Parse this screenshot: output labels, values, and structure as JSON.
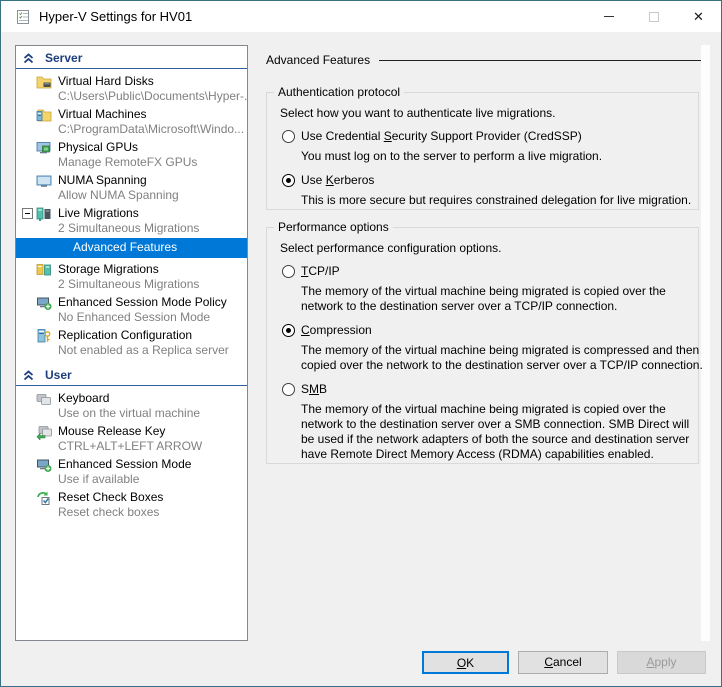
{
  "window": {
    "title": "Hyper-V Settings for HV01",
    "close_glyph": "✕"
  },
  "sidebar": {
    "sections": [
      {
        "label": "Server",
        "items": [
          {
            "label": "Virtual Hard Disks",
            "sublabel": "C:\\Users\\Public\\Documents\\Hyper-...",
            "icon": "virtual-hard-disks-icon"
          },
          {
            "label": "Virtual Machines",
            "sublabel": "C:\\ProgramData\\Microsoft\\Windo...",
            "icon": "virtual-machines-icon"
          },
          {
            "label": "Physical GPUs",
            "sublabel": "Manage RemoteFX GPUs",
            "icon": "physical-gpus-icon"
          },
          {
            "label": "NUMA Spanning",
            "sublabel": "Allow NUMA Spanning",
            "icon": "numa-spanning-icon"
          },
          {
            "label": "Live Migrations",
            "sublabel": "2 Simultaneous Migrations",
            "icon": "live-migrations-icon",
            "expanded": true,
            "children": [
              {
                "label": "Advanced Features",
                "selected": true
              }
            ]
          },
          {
            "label": "Storage Migrations",
            "sublabel": "2 Simultaneous Migrations",
            "icon": "storage-migrations-icon"
          },
          {
            "label": "Enhanced Session Mode Policy",
            "sublabel": "No Enhanced Session Mode",
            "icon": "enhanced-session-mode-policy-icon"
          },
          {
            "label": "Replication Configuration",
            "sublabel": "Not enabled as a Replica server",
            "icon": "replication-configuration-icon"
          }
        ]
      },
      {
        "label": "User",
        "items": [
          {
            "label": "Keyboard",
            "sublabel": "Use on the virtual machine",
            "icon": "keyboard-icon"
          },
          {
            "label": "Mouse Release Key",
            "sublabel": "CTRL+ALT+LEFT ARROW",
            "icon": "mouse-release-key-icon"
          },
          {
            "label": "Enhanced Session Mode",
            "sublabel": "Use if available",
            "icon": "enhanced-session-mode-icon"
          },
          {
            "label": "Reset Check Boxes",
            "sublabel": "Reset check boxes",
            "icon": "reset-check-boxes-icon"
          }
        ]
      }
    ]
  },
  "panel": {
    "title": "Advanced Features",
    "groups": [
      {
        "legend": "Authentication protocol",
        "intro": "Select how you want to authenticate live migrations.",
        "options": [
          {
            "pre": "Use Credential ",
            "key": "S",
            "post": "ecurity Support Provider (CredSSP)",
            "checked": false,
            "desc": "You must log on to the server to perform a live migration."
          },
          {
            "pre": "Use ",
            "key": "K",
            "post": "erberos",
            "checked": true,
            "desc": "This is more secure but requires constrained delegation for live migration."
          }
        ]
      },
      {
        "legend": "Performance options",
        "intro": "Select performance configuration options.",
        "options": [
          {
            "pre": "",
            "key": "T",
            "post": "CP/IP",
            "checked": false,
            "desc": "The memory of the virtual machine being migrated is copied over the network to the destination server over a TCP/IP connection."
          },
          {
            "pre": "",
            "key": "C",
            "post": "ompression",
            "checked": true,
            "desc": "The memory of the virtual machine being migrated is compressed and then copied over the network to the destination server over a TCP/IP connection."
          },
          {
            "pre": "S",
            "key": "M",
            "post": "B",
            "checked": false,
            "desc": "The memory of the virtual machine being migrated is copied over the network to the destination server over a SMB connection. SMB Direct will be used if the network adapters of both the source and destination server have Remote Direct Memory Access (RDMA) capabilities enabled."
          }
        ]
      }
    ]
  },
  "buttons": {
    "ok": {
      "key": "O",
      "post": "K"
    },
    "cancel": {
      "key": "C",
      "post": "ancel"
    },
    "apply": {
      "key": "A",
      "post": "pply"
    }
  },
  "colors": {
    "accent": "#0078d7",
    "selection": "#0078d7",
    "section_header_text": "#1c3e7e",
    "section_header_rule": "#2c5f9e",
    "window_border": "#38717f",
    "muted_text": "#808080",
    "dialog_bg": "#f0f0f0"
  }
}
